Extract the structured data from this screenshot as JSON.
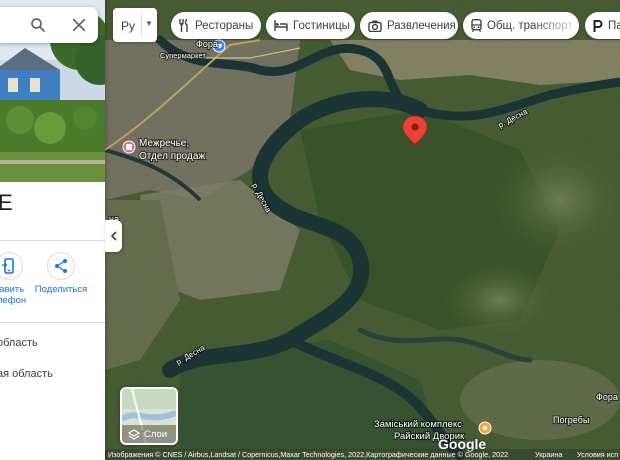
{
  "search": {
    "search_icon": "search-icon",
    "close_icon": "close-icon"
  },
  "panel": {
    "title": "E",
    "actions": [
      {
        "label_line1": "равить",
        "label_line2": "елефон",
        "icon": "send-to-phone-icon"
      },
      {
        "label_line1": "Поделиться",
        "label_line2": "",
        "icon": "share-icon"
      }
    ],
    "region_lines": [
      "область",
      "ая область"
    ]
  },
  "toolbar": {
    "language": "Ру",
    "chips": [
      {
        "label": "Рестораны",
        "icon": "restaurant-icon"
      },
      {
        "label": "Гостиницы",
        "icon": "hotel-icon"
      },
      {
        "label": "Развлечения",
        "icon": "camera-icon"
      },
      {
        "label": "Общ. транспорт",
        "icon": "transit-icon"
      },
      {
        "label": "Па",
        "icon": "parking-icon"
      }
    ]
  },
  "map": {
    "labels": {
      "fora_top": "Фора",
      "supermarket": "Супермаркет",
      "mezhreche_1": "Межречье,",
      "mezhreche_2": "Отдел продаж",
      "desna_1": "р. Десна",
      "desna_2": "р. Десна",
      "desna_3": "р. Десна",
      "complex_1": "Заміський комплекс",
      "complex_2": "Райский Дворик",
      "pogreby": "Погребы",
      "fora_right": "Фора",
      "edge_left": "на"
    },
    "colors": {
      "water": "#1d3a38",
      "forest": "#3c5530",
      "field": "#6b7c4d",
      "pin": "#ea4335"
    }
  },
  "layers": {
    "label": "Слои"
  },
  "attribution": {
    "text": "Изображения © CNES / Airbus,Landsat / Copernicus,Maxar Technologies, 2022,Картографические данные © Google, 2022",
    "country": "Украина",
    "terms": "Условия исп",
    "logo": "Google"
  }
}
